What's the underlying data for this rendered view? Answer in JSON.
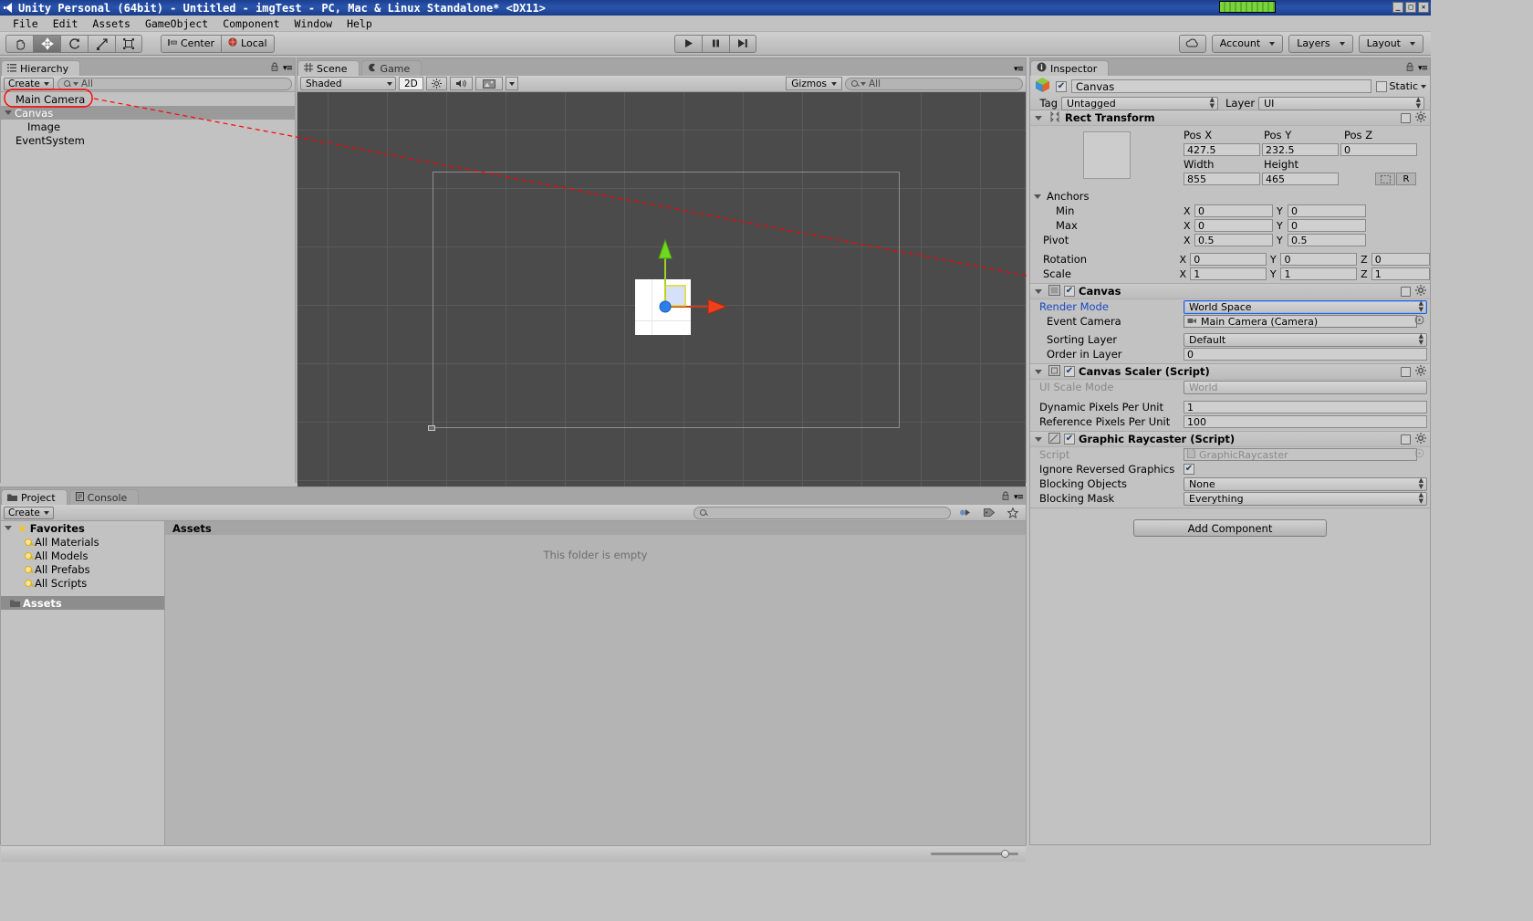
{
  "window": {
    "title": "Unity Personal (64bit) - Untitled - imgTest - PC, Mac & Linux Standalone* <DX11>",
    "minimize": "_",
    "maximize": "□",
    "close": "✕"
  },
  "menu": {
    "items": [
      "File",
      "Edit",
      "Assets",
      "GameObject",
      "Component",
      "Window",
      "Help"
    ]
  },
  "toolbar": {
    "tools": [
      {
        "name": "hand-tool",
        "glyph": "✋"
      },
      {
        "name": "move-tool",
        "glyph": "✥"
      },
      {
        "name": "rotate-tool",
        "glyph": "⟳"
      },
      {
        "name": "scale-tool",
        "glyph": "⤢"
      },
      {
        "name": "rect-tool",
        "glyph": "▣"
      }
    ],
    "pivot_label": "Center",
    "space_label": "Local",
    "play": "▶",
    "pause": "❚❚",
    "step": "▶❙",
    "cloud_label": "☁",
    "account_label": "Account",
    "layers_label": "Layers",
    "layout_label": "Layout"
  },
  "hierarchy": {
    "tab": "Hierarchy",
    "create_label": "Create",
    "search_placeholder": "All",
    "items": [
      {
        "label": "Main Camera",
        "depth": 0,
        "expandable": false,
        "selected": false,
        "annotated": true
      },
      {
        "label": "Canvas",
        "depth": 0,
        "expandable": true,
        "selected": true,
        "annotated": false
      },
      {
        "label": "Image",
        "depth": 1,
        "expandable": false,
        "selected": false,
        "annotated": false
      },
      {
        "label": "EventSystem",
        "depth": 0,
        "expandable": false,
        "selected": false,
        "annotated": false
      }
    ]
  },
  "scene": {
    "tab_scene": "Scene",
    "tab_game": "Game",
    "shading_mode": "Shaded",
    "mode_2d": "2D",
    "lighting_icon": "☀",
    "audio_icon": "🔊",
    "effects_icon": "▣",
    "gizmos_label": "Gizmos",
    "search_placeholder": "All"
  },
  "project": {
    "tab_project": "Project",
    "tab_console": "Console",
    "create_label": "Create",
    "search_placeholder": "",
    "favorites_label": "Favorites",
    "favorites": [
      "All Materials",
      "All Models",
      "All Prefabs",
      "All Scripts"
    ],
    "assets_label": "Assets",
    "assets_header": "Assets",
    "empty_message": "This folder is empty"
  },
  "inspector": {
    "tab": "Inspector",
    "object_name": "Canvas",
    "object_enabled": true,
    "static_label": "Static",
    "tag_label": "Tag",
    "tag_value": "Untagged",
    "layer_label": "Layer",
    "layer_value": "UI",
    "rect_transform": {
      "title": "Rect Transform",
      "pos_x_label": "Pos X",
      "pos_y_label": "Pos Y",
      "pos_z_label": "Pos Z",
      "pos_x": "427.5",
      "pos_y": "232.5",
      "pos_z": "0",
      "width_label": "Width",
      "height_label": "Height",
      "width": "855",
      "height": "465",
      "blueprint_label": "R",
      "anchors_label": "Anchors",
      "min_label": "Min",
      "min_x": "0",
      "min_y": "0",
      "max_label": "Max",
      "max_x": "0",
      "max_y": "0",
      "pivot_label": "Pivot",
      "pivot_x": "0.5",
      "pivot_y": "0.5",
      "rotation_label": "Rotation",
      "rot_x": "0",
      "rot_y": "0",
      "rot_z": "0",
      "scale_label": "Scale",
      "scale_x": "1",
      "scale_y": "1",
      "scale_z": "1",
      "axis_x": "X",
      "axis_y": "Y",
      "axis_z": "Z"
    },
    "canvas": {
      "title": "Canvas",
      "enabled": true,
      "render_mode_label": "Render Mode",
      "render_mode_value": "World Space",
      "event_camera_label": "Event Camera",
      "event_camera_value": "Main Camera (Camera)",
      "sorting_layer_label": "Sorting Layer",
      "sorting_layer_value": "Default",
      "order_in_layer_label": "Order in Layer",
      "order_in_layer_value": "0"
    },
    "canvas_scaler": {
      "title": "Canvas Scaler (Script)",
      "enabled": true,
      "ui_scale_mode_label": "UI Scale Mode",
      "ui_scale_mode_value": "World",
      "dynamic_ppu_label": "Dynamic Pixels Per Unit",
      "dynamic_ppu_value": "1",
      "reference_ppu_label": "Reference Pixels Per Unit",
      "reference_ppu_value": "100"
    },
    "graphic_raycaster": {
      "title": "Graphic Raycaster (Script)",
      "enabled": true,
      "script_label": "Script",
      "script_value": "GraphicRaycaster",
      "ignore_reversed_label": "Ignore Reversed Graphics",
      "ignore_reversed_checked": true,
      "blocking_objects_label": "Blocking Objects",
      "blocking_objects_value": "None",
      "blocking_mask_label": "Blocking Mask",
      "blocking_mask_value": "Everything"
    },
    "add_component_label": "Add Component"
  },
  "colors": {
    "annotation_red": "#ff0000",
    "accent_blue": "#1a49c4",
    "title_blue": "#2a55ad",
    "panel_gray": "#c2c2c2",
    "scene_bg": "#4b4b4b"
  }
}
